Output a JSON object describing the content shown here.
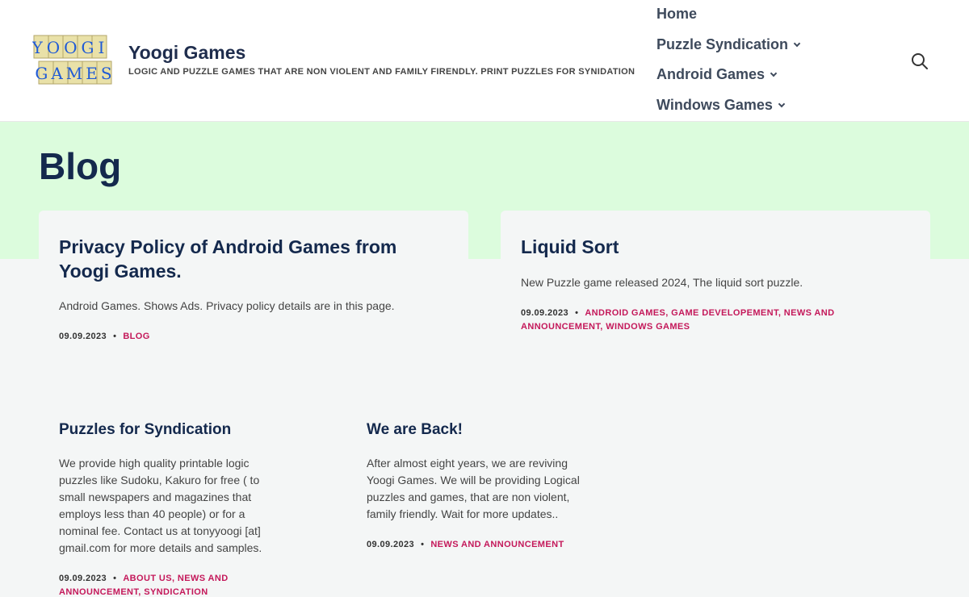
{
  "site": {
    "logo_line1": "YOOGI",
    "logo_line2": "GAMES",
    "title": "Yoogi Games",
    "tagline": "LOGIC AND PUZZLE GAMES THAT ARE NON VIOLENT AND FAMILY FIRENDLY. PRINT PUZZLES FOR SYNIDATION"
  },
  "nav": {
    "items": [
      {
        "label": "Home"
      },
      {
        "label": "Puzzle Syndication"
      },
      {
        "label": "Android Games"
      },
      {
        "label": "Windows Games"
      }
    ],
    "search_icon": "search-icon"
  },
  "page": {
    "title": "Blog"
  },
  "posts": [
    {
      "title": "Privacy Policy of Android Games from Yoogi Games.",
      "excerpt": "Android Games. Shows Ads. Privacy policy details are in this page.",
      "date": "09.09.2023",
      "categories": "BLOG"
    },
    {
      "title": "Liquid Sort",
      "excerpt": "New Puzzle game released 2024, The liquid sort puzzle.",
      "date": "09.09.2023",
      "categories": "ANDROID GAMES, GAME DEVELOPEMENT, NEWS AND ANNOUNCEMENT, WINDOWS GAMES"
    },
    {
      "title": "Puzzles for Syndication",
      "excerpt": "We provide high quality printable logic puzzles like Sudoku, Kakuro for free ( to small newspapers and magazines that employs less than 40 people) or for a nominal fee. Contact us at tonyyoogi [at] gmail.com for more details and samples.",
      "date": "09.09.2023",
      "categories": "ABOUT US, NEWS AND ANNOUNCEMENT, SYNDICATION"
    },
    {
      "title": "We are Back!",
      "excerpt": "After almost eight years, we are reviving Yoogi Games. We will be providing Logical puzzles and games, that are non violent, family friendly. Wait for more updates..",
      "date": "09.09.2023",
      "categories": "NEWS AND ANNOUNCEMENT"
    }
  ],
  "colors": {
    "heading": "#14294d",
    "accent": "#c4185a",
    "hero_bg": "#dcfcdd",
    "page_bg": "#f4f6f6"
  }
}
